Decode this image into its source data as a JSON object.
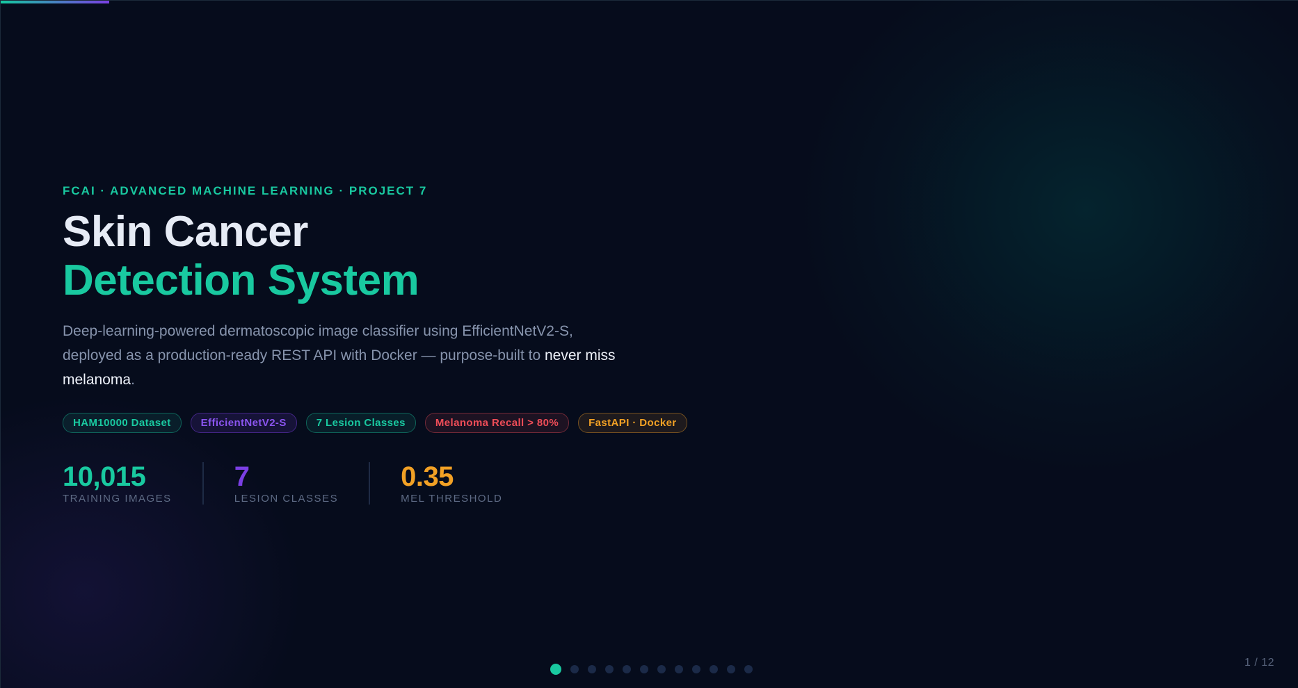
{
  "slide": {
    "eyebrow": "FCAI · ADVANCED MACHINE LEARNING · PROJECT 7",
    "title_line1": "Skin Cancer",
    "title_line2": "Detection System",
    "description_prefix": "Deep-learning-powered dermatoscopic image classifier using EfficientNetV2-S, deployed as a production-ready REST API with Docker — purpose-built to ",
    "description_highlight": "never miss melanoma",
    "description_suffix": ".",
    "tags": [
      {
        "label": "HAM10000 Dataset",
        "color": "#19c9a0"
      },
      {
        "label": "EfficientNetV2-S",
        "color": "#8b55f0"
      },
      {
        "label": "7 Lesion Classes",
        "color": "#19c9a0"
      },
      {
        "label": "Melanoma Recall > 80%",
        "color": "#ef4d58"
      },
      {
        "label": "FastAPI · Docker",
        "color": "#f2a125"
      }
    ],
    "stats": [
      {
        "value": "10,015",
        "label": "TRAINING IMAGES",
        "color": "#19c9a0"
      },
      {
        "value": "7",
        "label": "LESION CLASSES",
        "color": "#7b3fe4"
      },
      {
        "value": "0.35",
        "label": "MEL THRESHOLD",
        "color": "#f2a125"
      }
    ]
  },
  "navigation": {
    "current_slide": 1,
    "total_slides": 12,
    "page_counter": "1 / 12",
    "progress_fraction": 0.083
  },
  "theme": {
    "accent_teal": "#19c9a0",
    "accent_purple": "#7b3fe4",
    "accent_red": "#ef4d58",
    "accent_amber": "#f2a125",
    "background": "#060c1c"
  }
}
